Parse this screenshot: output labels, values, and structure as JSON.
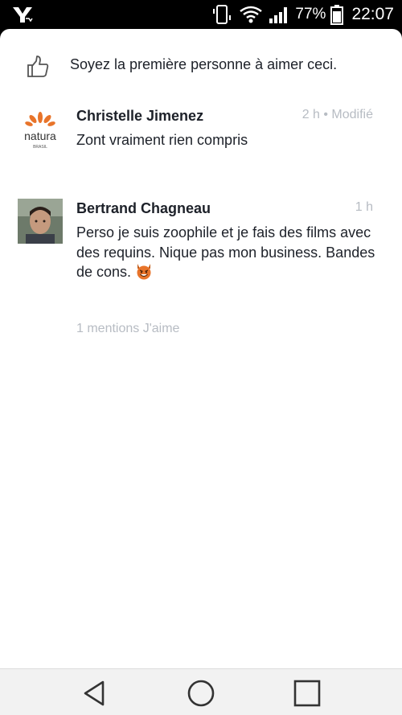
{
  "status_bar": {
    "battery_percent": "77%",
    "time": "22:07",
    "icons": [
      "app-logo-icon",
      "vibrate-icon",
      "wifi-icon",
      "signal-icon",
      "battery-icon"
    ]
  },
  "likes": {
    "text": "Soyez la première personne à aimer ceci.",
    "icon": "thumbs-up-icon"
  },
  "comments": [
    {
      "author": "Christelle Jimenez",
      "meta": "2 h • Modifié",
      "text": "Zont vraiment rien compris",
      "avatar_brand": "natura",
      "avatar_sub": "BRASIL"
    },
    {
      "author": "Bertrand Chagneau",
      "meta": "1 h",
      "text": "Perso je suis zoophile et je fais des films avec des requins. Nique pas mon business.  Bandes de cons.",
      "emoji": "smiling-devil-emoji",
      "likes_text": "1 mentions J'aime"
    }
  ],
  "nav": {
    "buttons": [
      "back-icon",
      "home-icon",
      "recents-icon"
    ]
  },
  "colors": {
    "text_primary": "#1d2129",
    "text_muted": "#b7bcc3",
    "nav_bg": "#f2f2f2",
    "devil_orange": "#e8742a"
  }
}
